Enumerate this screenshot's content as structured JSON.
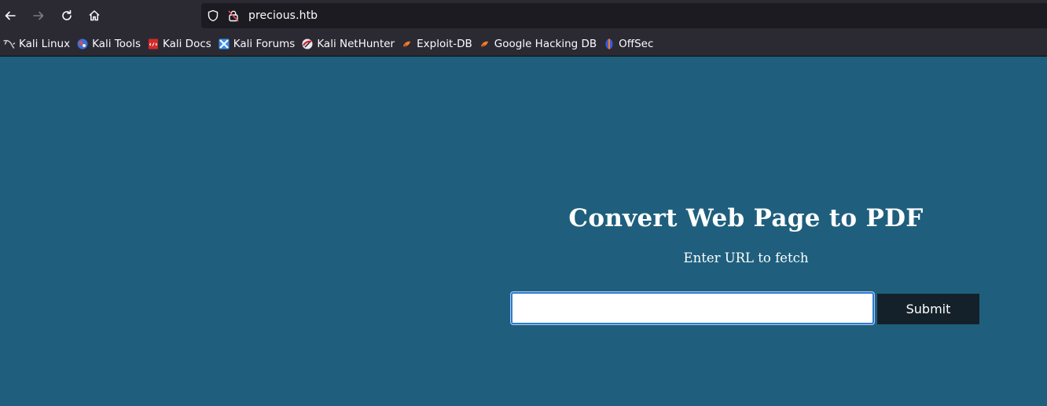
{
  "browser": {
    "nav": {
      "back_icon": "arrow-left-icon",
      "forward_icon": "arrow-right-icon",
      "reload_icon": "reload-icon",
      "home_icon": "home-icon"
    },
    "url": "precious.htb"
  },
  "bookmarks": [
    {
      "label": "Kali Linux",
      "icon": "kali-dragon-icon"
    },
    {
      "label": "Kali Tools",
      "icon": "kali-tools-icon"
    },
    {
      "label": "Kali Docs",
      "icon": "kali-docs-icon"
    },
    {
      "label": "Kali Forums",
      "icon": "kali-forums-icon"
    },
    {
      "label": "Kali NetHunter",
      "icon": "kali-nethunter-icon"
    },
    {
      "label": "Exploit-DB",
      "icon": "exploit-db-icon"
    },
    {
      "label": "Google Hacking DB",
      "icon": "ghdb-icon"
    },
    {
      "label": "OffSec",
      "icon": "offsec-icon"
    }
  ],
  "page": {
    "title": "Convert Web Page to PDF",
    "subtitle": "Enter URL to fetch",
    "url_input_value": "",
    "submit_label": "Submit"
  },
  "colors": {
    "page_background": "#1f5f7d",
    "submit_background": "#14212b",
    "browser_chrome": "#2b2a33"
  }
}
